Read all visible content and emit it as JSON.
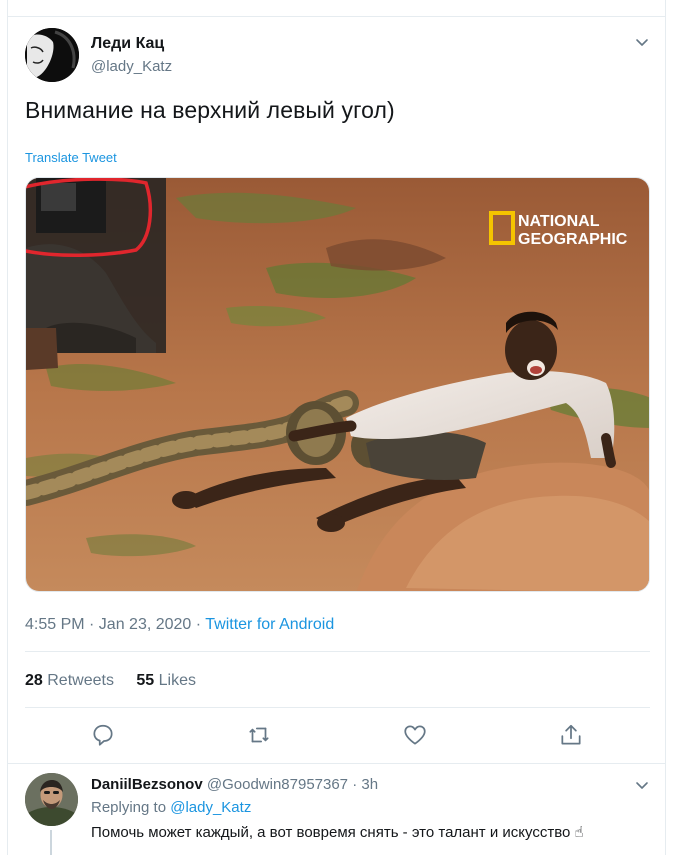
{
  "tweet": {
    "author_name": "Леди Кац",
    "author_handle": "@lady_Katz",
    "text": "Внимание на верхний левый угол)",
    "translate_label": "Translate Tweet",
    "media": {
      "watermark_line1": "NATIONAL",
      "watermark_line2": "GEOGRAPHIC"
    },
    "timestamp": "4:55 PM · Jan 23, 2020 · ",
    "source": "Twitter for Android",
    "retweets_count": "28",
    "retweets_label": "Retweets",
    "likes_count": "55",
    "likes_label": "Likes"
  },
  "actions": {
    "icons": [
      "reply-icon",
      "retweet-icon",
      "like-icon",
      "share-icon"
    ]
  },
  "reply": {
    "author_name": "DaniilBezsonov",
    "author_handle": "@Goodwin87957367 · 3h",
    "replying_prefix": "Replying to ",
    "replying_to": "@lady_Katz",
    "text": "Помочь может каждый, а вот вовремя снять - это талант и искусство ☝"
  },
  "colors": {
    "accent": "#1b95e0",
    "muted": "#657786",
    "text": "#14171a",
    "divider": "#e6ecf0",
    "highlight": "#e0262d",
    "natgeo_yellow": "#f5c400"
  }
}
